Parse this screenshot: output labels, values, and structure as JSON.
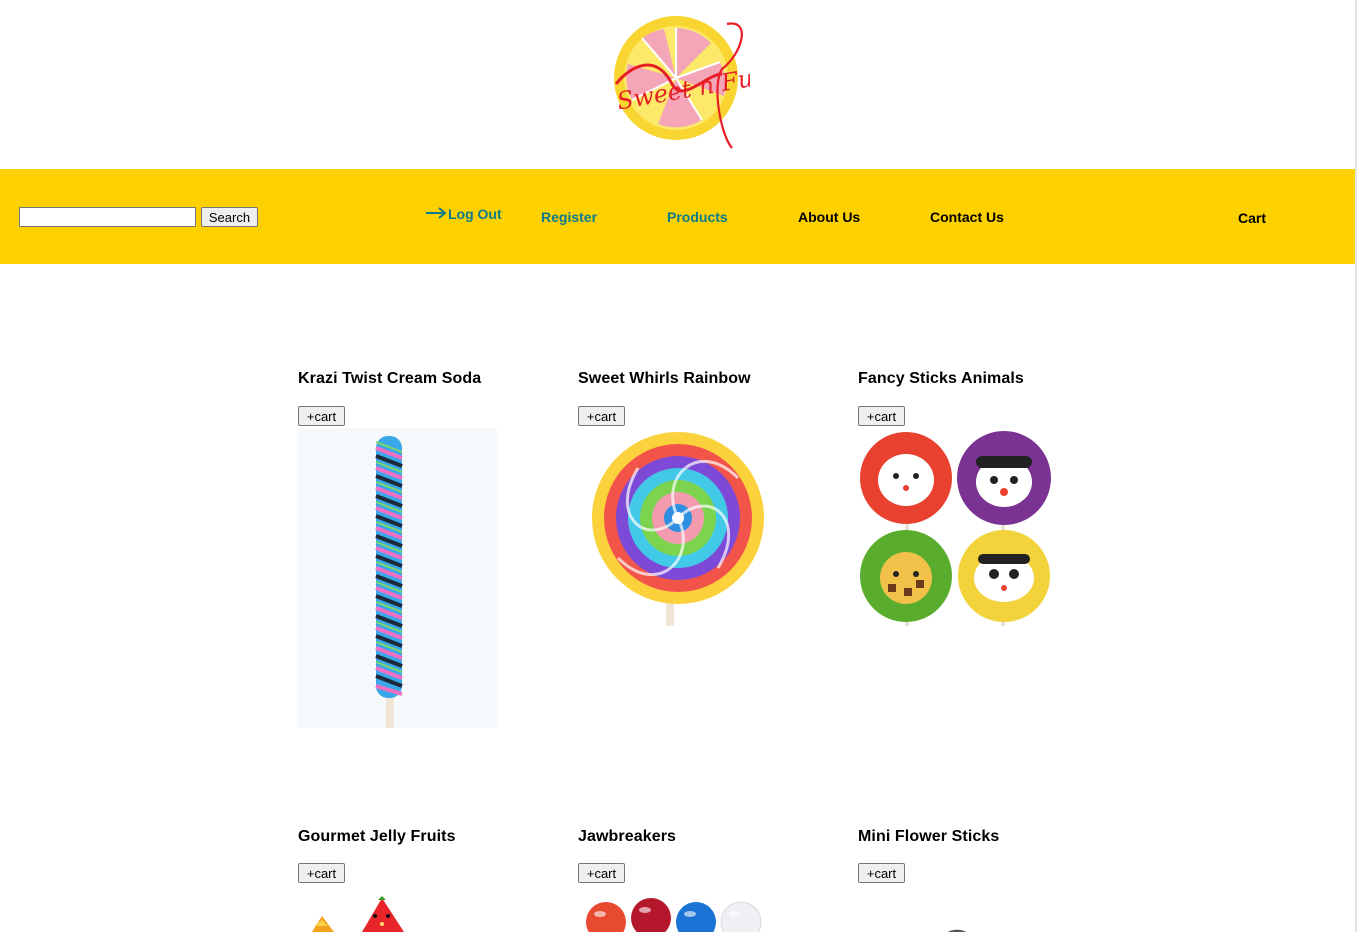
{
  "header": {
    "logo_text": "Sweet n Fun"
  },
  "nav": {
    "search_placeholder": "",
    "search_value": "",
    "search_button": "Search",
    "logout": "Log Out",
    "register": "Register",
    "products": "Products",
    "about": "About Us",
    "contact": "Contact Us",
    "cart": "Cart",
    "teal_color": "#0d7c8a",
    "bar_color": "#fdd000"
  },
  "products": [
    {
      "name": "Krazi Twist Cream Soda",
      "button": "+cart",
      "image": "twisted-lollipop-pink-blue"
    },
    {
      "name": "Sweet Whirls Rainbow",
      "button": "+cart",
      "image": "rainbow-swirl-lollipop"
    },
    {
      "name": "Fancy Sticks Animals",
      "button": "+cart",
      "image": "animal-face-lollipops"
    },
    {
      "name": "Gourmet Jelly Fruits",
      "button": "+cart",
      "image": "jelly-fruits"
    },
    {
      "name": "Jawbreakers",
      "button": "+cart",
      "image": "jawbreaker-balls"
    },
    {
      "name": "Mini Flower Sticks",
      "button": "+cart",
      "image": "mini-flower-lollipops"
    }
  ]
}
